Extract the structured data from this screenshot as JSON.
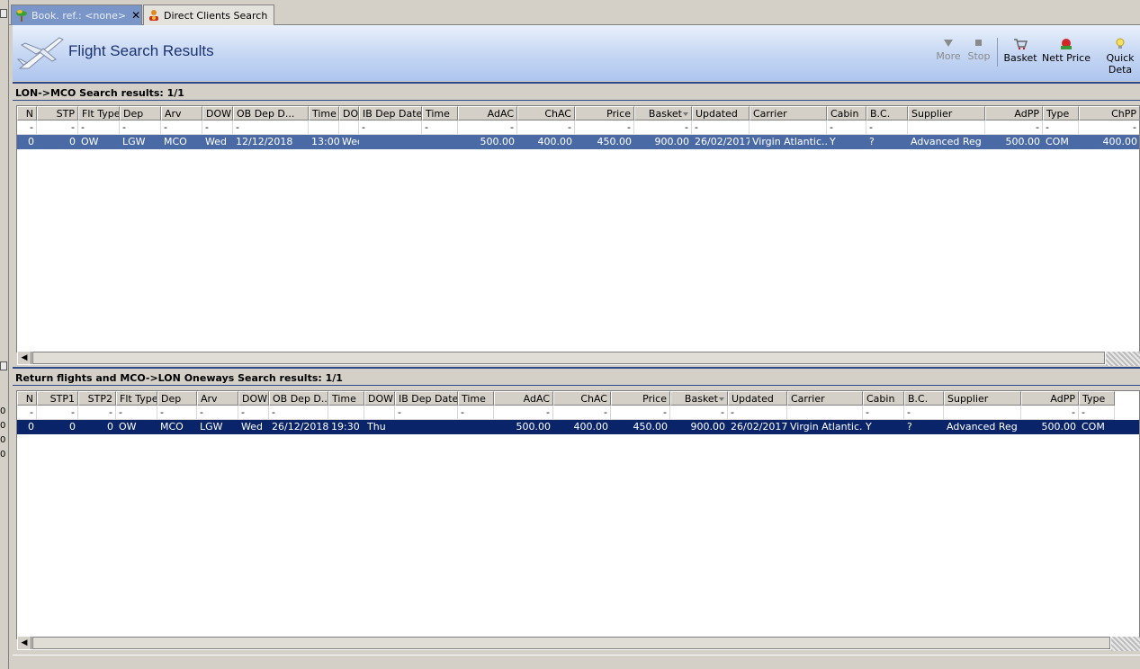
{
  "tabs": [
    {
      "label": "Book. ref.: <none>",
      "active": true
    },
    {
      "label": "Direct Clients Search",
      "active": false
    }
  ],
  "header": {
    "title": "Flight Search Results"
  },
  "toolbar": {
    "more": "More",
    "stop": "Stop",
    "basket": "Basket",
    "nett_price": "Nett Price",
    "quick_details": "Quick Deta"
  },
  "left_strip_numbers": [
    "0",
    "0",
    "0",
    "0"
  ],
  "outbound": {
    "title": "LON->MCO Search results: 1/1",
    "columns": [
      "N",
      "STP",
      "Flt Type",
      "Dep",
      "Arv",
      "DOW",
      "OB Dep D...",
      "Time",
      "DOW",
      "IB Dep Date",
      "Time",
      "AdAC",
      "ChAC",
      "Price",
      "Basket",
      "Updated",
      "Carrier",
      "Cabin",
      "B.C.",
      "Supplier",
      "AdPP",
      "Type",
      "ChPP"
    ],
    "filter": [
      "-",
      "-",
      "-",
      "-",
      "-",
      "-",
      "-",
      "",
      "",
      "-",
      "-",
      "-",
      "-",
      "-",
      "-",
      "-",
      "",
      "-",
      "-",
      "",
      "-",
      "-",
      "-"
    ],
    "rows": [
      [
        "0",
        "0",
        "OW",
        "LGW",
        "MCO",
        "Wed",
        "12/12/2018",
        "13:00",
        "Wed",
        "",
        "",
        "500.00",
        "400.00",
        "450.00",
        "900.00",
        "26/02/2017",
        "Virgin Atlantic...",
        "Y",
        "?",
        "Advanced Reg",
        "500.00",
        "COM",
        "400.00"
      ]
    ]
  },
  "return": {
    "title": "Return flights and MCO->LON Oneways Search results: 1/1",
    "columns": [
      "N",
      "STP1",
      "STP2",
      "Flt Type",
      "Dep",
      "Arv",
      "DOW",
      "OB Dep D...",
      "Time",
      "DOW",
      "IB Dep Date",
      "Time",
      "AdAC",
      "ChAC",
      "Price",
      "Basket",
      "Updated",
      "Carrier",
      "Cabin",
      "B.C.",
      "Supplier",
      "AdPP",
      "Type"
    ],
    "filter": [
      "-",
      "-",
      "-",
      "-",
      "-",
      "-",
      "-",
      "-",
      "",
      "",
      "-",
      "-",
      "-",
      "-",
      "-",
      "-",
      "-",
      "",
      "-",
      "-",
      "",
      "-",
      "-"
    ],
    "rows": [
      [
        "0",
        "0",
        "0",
        "OW",
        "MCO",
        "LGW",
        "Wed",
        "26/12/2018",
        "19:30",
        "Thu",
        "",
        "",
        "500.00",
        "400.00",
        "450.00",
        "900.00",
        "26/02/2017",
        "Virgin Atlantic...",
        "Y",
        "?",
        "Advanced Reg",
        "500.00",
        "COM"
      ]
    ]
  }
}
